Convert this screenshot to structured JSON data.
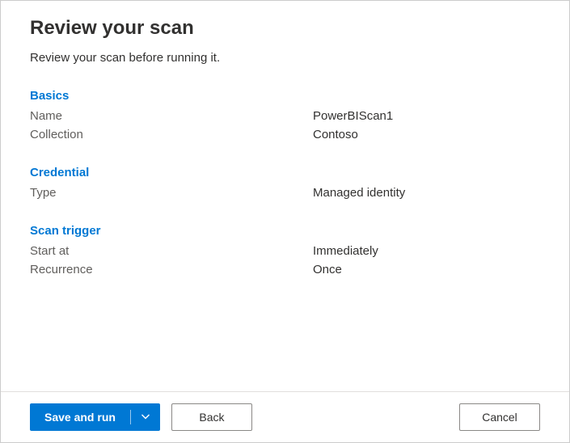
{
  "title": "Review your scan",
  "subtitle": "Review your scan before running it.",
  "sections": {
    "basics": {
      "heading": "Basics",
      "nameLabel": "Name",
      "nameValue": "PowerBIScan1",
      "collectionLabel": "Collection",
      "collectionValue": "Contoso"
    },
    "credential": {
      "heading": "Credential",
      "typeLabel": "Type",
      "typeValue": "Managed identity"
    },
    "scanTrigger": {
      "heading": "Scan trigger",
      "startAtLabel": "Start at",
      "startAtValue": "Immediately",
      "recurrenceLabel": "Recurrence",
      "recurrenceValue": "Once"
    }
  },
  "buttons": {
    "saveAndRun": "Save and run",
    "back": "Back",
    "cancel": "Cancel"
  }
}
